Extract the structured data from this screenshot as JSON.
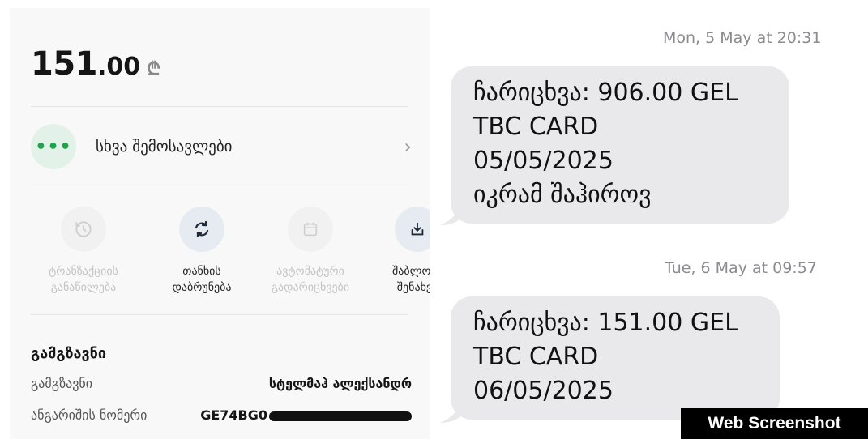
{
  "bank": {
    "balance_int": "151",
    "balance_dec": ".00",
    "currency_symbol": "₾",
    "other_income_label": "სხვა შემოსავლები",
    "other_income_icon": "more-dots-icon",
    "actions": [
      {
        "icon": "transaction-icon",
        "line1": "ტრანზაქციის",
        "line2": "განაწილება",
        "enabled": false
      },
      {
        "icon": "refund-icon",
        "line1": "თანხის",
        "line2": "დაბრუნება",
        "enabled": true
      },
      {
        "icon": "calendar-icon",
        "line1": "ავტომატური",
        "line2": "გადარიცხვები",
        "enabled": false
      },
      {
        "icon": "download-icon",
        "line1": "შაბლონა",
        "line2": "შენახვა",
        "enabled": true
      }
    ],
    "sender_section_title": "გამგზავნი",
    "sender_label": "გამგზავნი",
    "sender_value": "სტელმაჰ ალექსანდრ",
    "account_label": "ანგარიშის ნომერი",
    "account_value": "GE74BG0"
  },
  "sms": [
    {
      "time": "Mon, 5 May at 20:31",
      "lines": [
        "ჩარიცხვა: 906.00 GEL",
        "TBC CARD",
        "05/05/2025",
        "იკრამ შაჰიროვ"
      ]
    },
    {
      "time": "Tue, 6 May at 09:57",
      "lines": [
        "ჩარიცხვა: 151.00 GEL",
        "TBC CARD",
        "06/05/2025"
      ]
    }
  ],
  "watermark": "Web Screenshot",
  "colors": {
    "accent_green": "#1fa34a",
    "bubble_gray": "#e9e9eb",
    "panel_bg": "#f8f8f8"
  }
}
